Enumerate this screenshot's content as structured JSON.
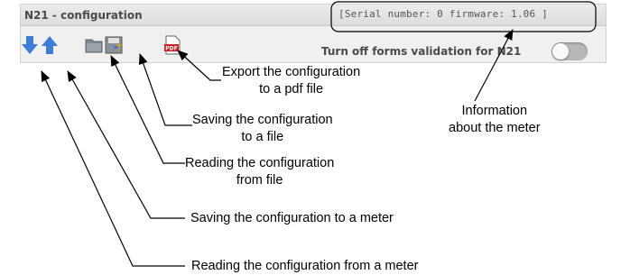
{
  "window": {
    "title": "N21 - configuration",
    "info": "[Serial number: 0 firmware: 1.06 ]",
    "validation_label": "Turn off forms validation for N21",
    "validation_toggle_on": false
  },
  "toolbar": {
    "icons": [
      "arrow-down-icon",
      "arrow-up-icon",
      "folder-icon",
      "save-icon",
      "pdf-icon"
    ]
  },
  "callouts": {
    "export_pdf": {
      "line1": "Export the configuration",
      "line2": "to a pdf file"
    },
    "info": {
      "line1": "Information",
      "line2": "about the meter"
    },
    "save_file": {
      "line1": "Saving the configuration",
      "line2": "to a file"
    },
    "read_file": {
      "line1": "Reading the configuration",
      "line2": "from file"
    },
    "save_meter": "Saving the configuration to a meter",
    "read_meter": "Reading the configuration from a meter"
  }
}
